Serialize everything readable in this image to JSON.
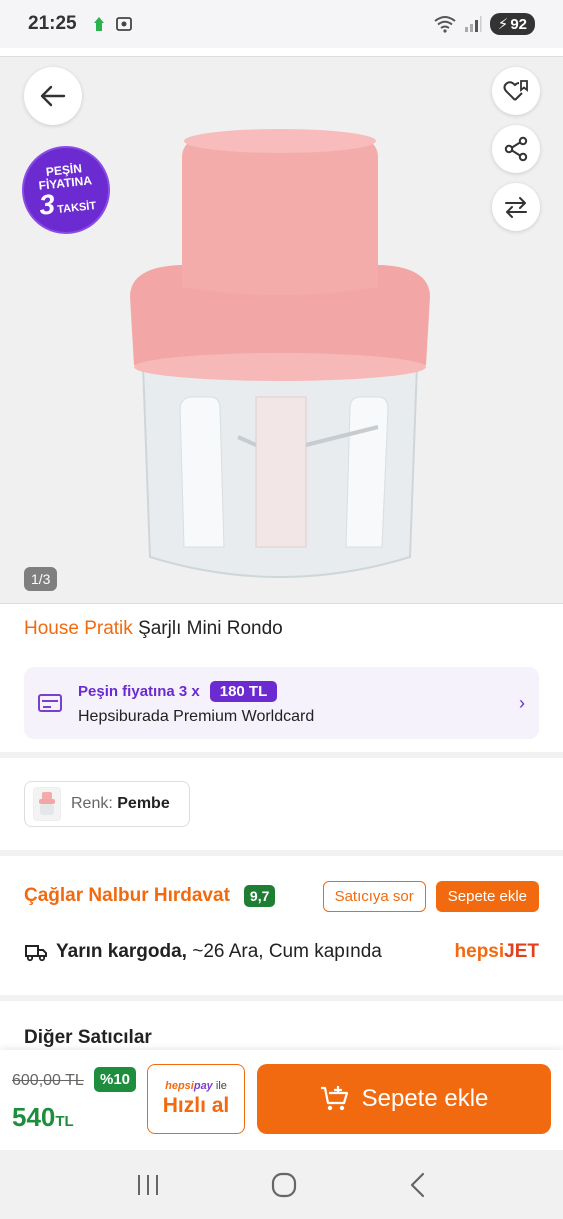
{
  "status": {
    "time": "21:25",
    "battery": "92"
  },
  "gallery": {
    "page_indicator": "1/3"
  },
  "promo_badge": {
    "line1": "PEŞİN",
    "line2": "FİYATINA",
    "number": "3",
    "word": "TAKSİT"
  },
  "product": {
    "brand": "House Pratik",
    "name": "Şarjlı Mini Rondo"
  },
  "installment": {
    "label": "Peşin fiyatına 3 x",
    "amount": "180 TL",
    "card_name": "Hepsiburada Premium Worldcard"
  },
  "color": {
    "label": "Renk:",
    "value": "Pembe"
  },
  "seller": {
    "name": "Çağlar Nalbur Hırdavat",
    "score": "9,7",
    "ask_label": "Satıcıya sor",
    "add_label": "Sepete ekle"
  },
  "shipping": {
    "bold": "Yarın kargoda,",
    "rest": "~26 Ara, Cum kapında",
    "carrier_a": "hepsi",
    "carrier_b": "JET"
  },
  "other_sellers_title": "Diğer Satıcılar",
  "price": {
    "old": "600,00 TL",
    "discount": "%10",
    "new": "540",
    "currency": "TL"
  },
  "quick_buy": {
    "brand": "hepsi",
    "brand2": "pay",
    "suffix": "ile",
    "label": "Hızlı al"
  },
  "main_button": {
    "label": "Sepete ekle"
  },
  "colors": {
    "accent": "#f26a0f",
    "purple": "#6b2bd0",
    "green": "#1e8e3e"
  }
}
